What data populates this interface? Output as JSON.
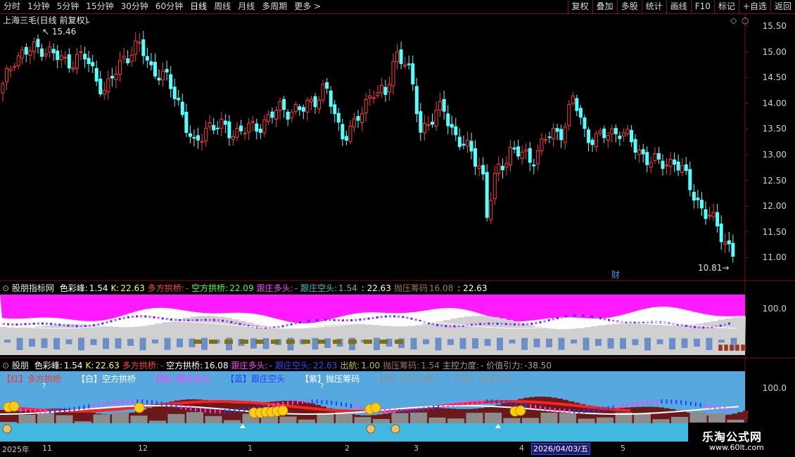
{
  "toolbar": {
    "timeframes": [
      "分时",
      "1分钟",
      "5分钟",
      "15分钟",
      "30分钟",
      "60分钟",
      "日线",
      "周线",
      "月线",
      "多周期",
      "更多 >"
    ],
    "active": "日线",
    "right_buttons": [
      "复权",
      "叠加",
      "多股",
      "统计",
      "画线",
      "F10",
      "标记",
      "+自选",
      "返回"
    ]
  },
  "main_chart": {
    "title": "上海三毛(日线 前复权)",
    "high_label": "15.46",
    "low_label": "10.81",
    "fin_badge": "财",
    "price_ticks": [
      "15.50",
      "15.00",
      "14.50",
      "14.00",
      "13.50",
      "13.00",
      "12.50",
      "12.00",
      "11.50",
      "11.00"
    ],
    "up_color": "#ff3a3a",
    "down_color": "#54ffff"
  },
  "indicator1": {
    "name": "股朋指标网",
    "items": [
      {
        "label": "色彩峰:",
        "value": "1.54",
        "color": "#ffffff"
      },
      {
        "label": "K:",
        "value": "22.63",
        "color": "#ffff40"
      },
      {
        "label": "多方拱桥:",
        "value": "-",
        "color": "#ff4040"
      },
      {
        "label": "空方拱桥:",
        "value": "22.09",
        "color": "#40ff40"
      },
      {
        "label": "跟庄多头:",
        "value": "-",
        "color": "#ff40ff"
      },
      {
        "label": "跟庄空头:",
        "value": "1.54",
        "color": "#40c0c0"
      },
      {
        "label": "",
        "value": ": 22.63",
        "color": "#ffffff"
      },
      {
        "label": "抛压筹码",
        "value": "16.08",
        "color": "#a07070"
      },
      {
        "label": "",
        "value": ": 22.63",
        "color": "#ffffff"
      }
    ],
    "axis_label": "100.0"
  },
  "indicator2": {
    "name": "股朋",
    "items": [
      {
        "label": "色彩峰:",
        "value": "1.54",
        "color": "#ffffff"
      },
      {
        "label": "K:",
        "value": "22.63",
        "color": "#ffff40"
      },
      {
        "label": "多方拱桥:",
        "value": "-",
        "color": "#ff4040"
      },
      {
        "label": "空方拱桥:",
        "value": "16.08",
        "color": "#ffffff"
      },
      {
        "label": "跟庄多头:",
        "value": "-",
        "color": "#ff40ff"
      },
      {
        "label": "跟庄空头:",
        "value": "22.63",
        "color": "#4040ff"
      },
      {
        "label": "出航:",
        "value": "1.00",
        "color": "#c0c040"
      },
      {
        "label": "抛压筹码:",
        "value": "1.54",
        "color": "#a07070"
      },
      {
        "label": "主控力度:",
        "value": "-",
        "color": "#a0a0a0"
      },
      {
        "label": "价值引力:",
        "value": "-38.50",
        "color": "#a0a0a0"
      }
    ],
    "legend": [
      {
        "text": "【红】多方拱桥",
        "color": "#ff3030"
      },
      {
        "text": "【白】空方拱桥",
        "color": "#ffffff"
      },
      {
        "text": "【粉】跟庄多头",
        "color": "#ff40ff"
      },
      {
        "text": "【蓝】跟庄空头",
        "color": "#2040ff"
      },
      {
        "text": "【紫】抛压筹码",
        "color": "#ffffff"
      },
      {
        "text": "【灰】主控力度",
        "color": "#909090"
      },
      {
        "text": "【-灰】价值引力",
        "color": "#909090"
      }
    ],
    "axis_label": "100.0"
  },
  "timeline": {
    "labels": [
      "2025年",
      "11",
      "12",
      "1",
      "2",
      "3",
      "4",
      "5"
    ],
    "selected_date": "2026/04/03/五"
  },
  "watermark": {
    "name": "乐淘公式网",
    "url": "www.60lt.com"
  }
}
